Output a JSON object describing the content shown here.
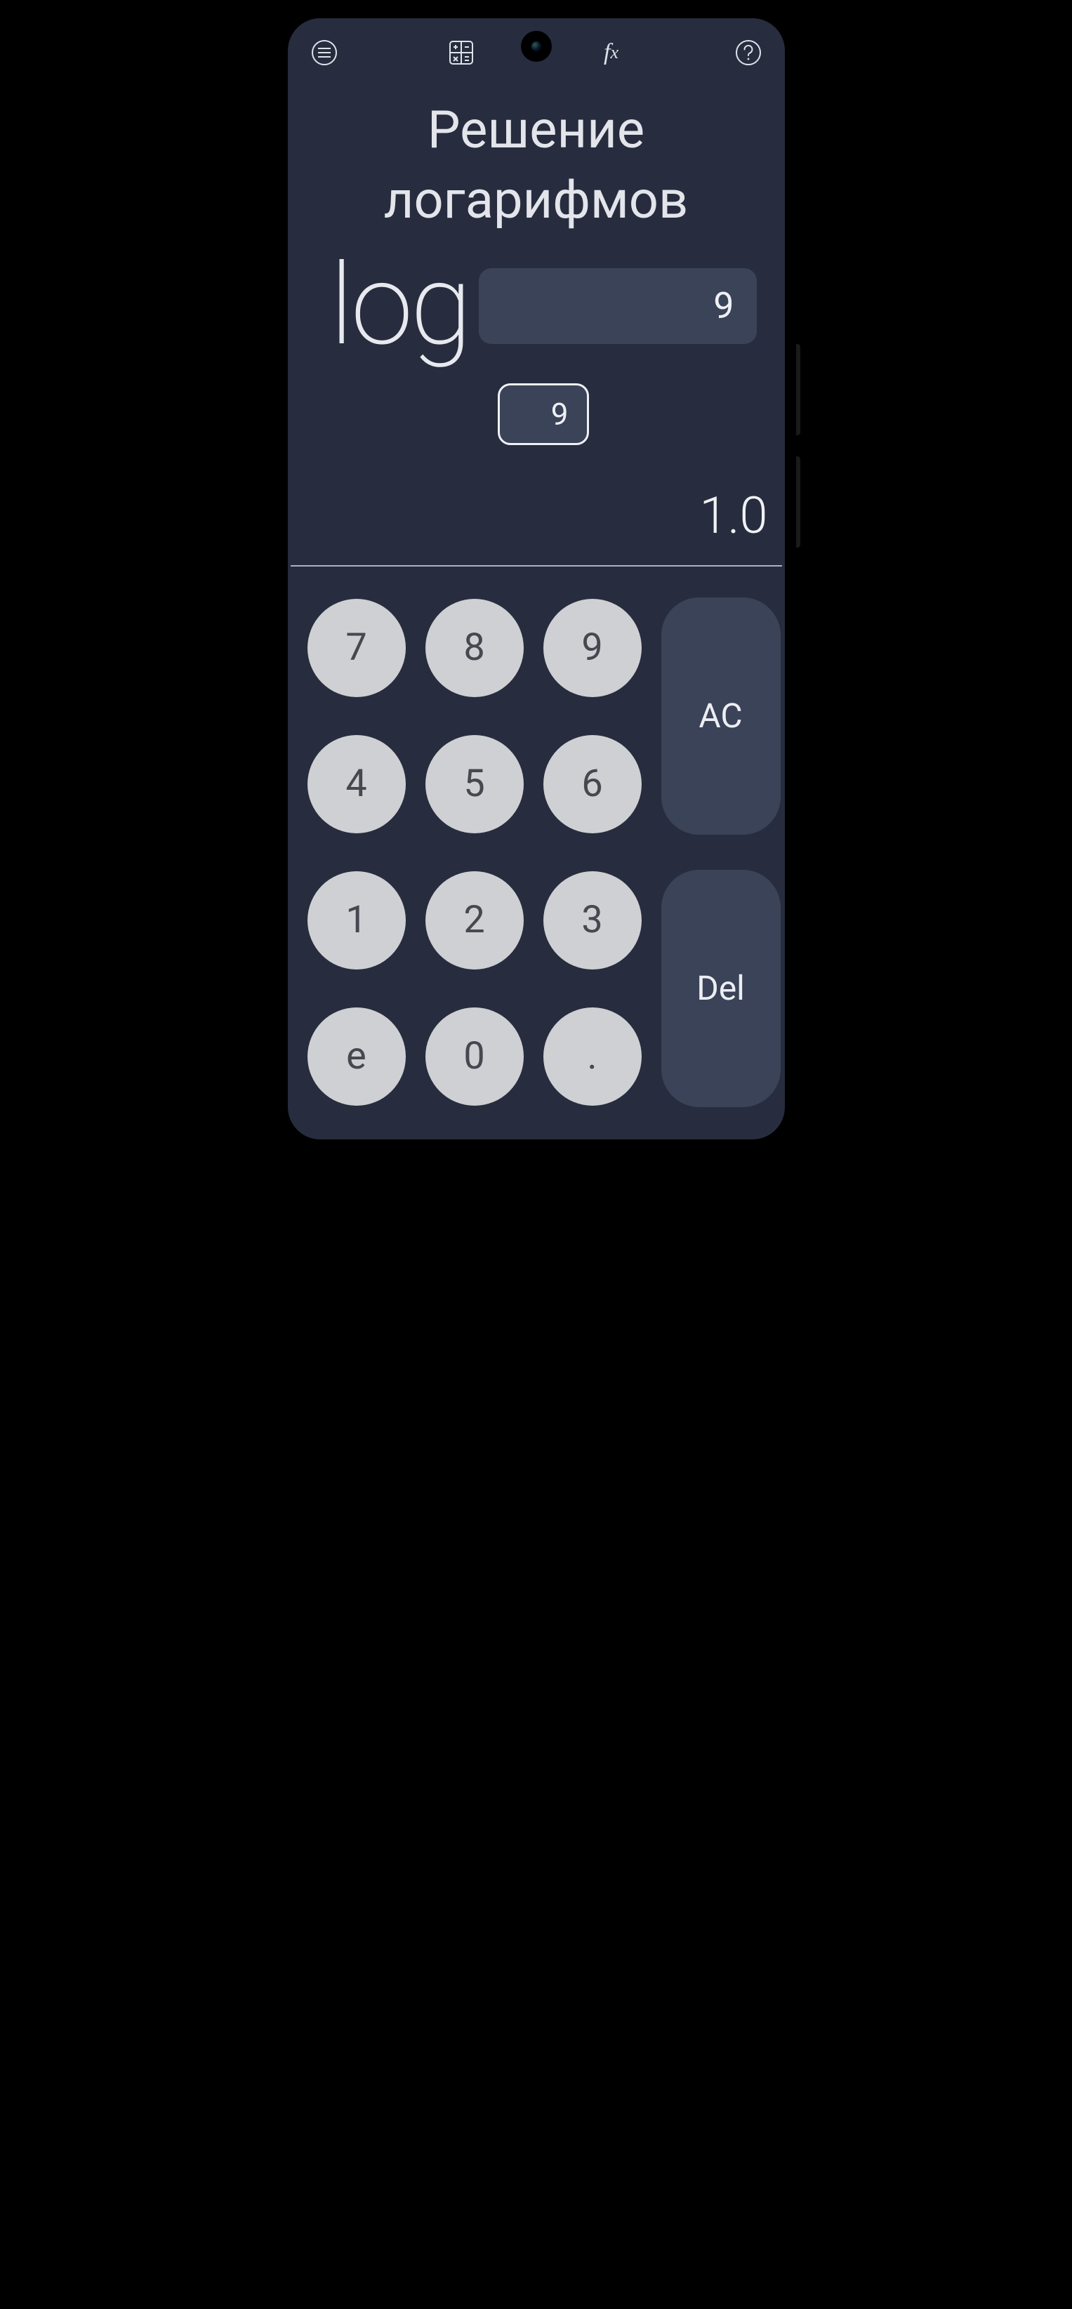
{
  "title": "Решение логарифмов",
  "expression": {
    "symbol": "log",
    "argument": "9",
    "base": "9"
  },
  "result": "1.0",
  "keypad": {
    "r1c1": "7",
    "r1c2": "8",
    "r1c3": "9",
    "r2c1": "4",
    "r2c2": "5",
    "r2c3": "6",
    "r3c1": "1",
    "r3c2": "2",
    "r3c3": "3",
    "r4c1": "e",
    "r4c2": "0",
    "r4c3": ".",
    "ac": "AC",
    "del": "Del"
  },
  "icons": {
    "menu": "menu-icon",
    "calc": "calc-grid-icon",
    "fx": "fx-icon",
    "help": "help-icon"
  }
}
